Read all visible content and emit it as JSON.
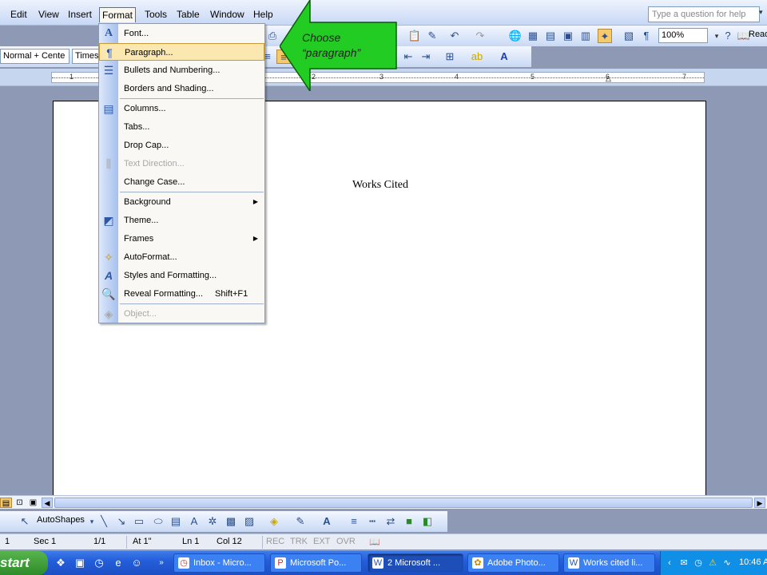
{
  "menubar": {
    "items": [
      "Edit",
      "View",
      "Insert",
      "Format",
      "Tools",
      "Table",
      "Window",
      "Help"
    ],
    "help_placeholder": "Type a question for help"
  },
  "toolbar_std": {
    "zoom": "100%",
    "read_label": "Read"
  },
  "toolbar_fmt": {
    "style": "Normal + Cente",
    "font": "Times"
  },
  "ruler": {
    "numbers": [
      "1",
      "1",
      "2",
      "3",
      "4",
      "5",
      "6",
      "7"
    ]
  },
  "format_menu": {
    "items": [
      {
        "label": "Font...",
        "icon": "font-icon"
      },
      {
        "label": "Paragraph...",
        "icon": "paragraph-icon"
      },
      {
        "label": "Bullets and Numbering...",
        "icon": "bullets-icon"
      },
      {
        "label": "Borders and Shading...",
        "icon": ""
      },
      {
        "label": "Columns...",
        "icon": "columns-icon"
      },
      {
        "label": "Tabs...",
        "icon": ""
      },
      {
        "label": "Drop Cap...",
        "icon": ""
      },
      {
        "label": "Text Direction...",
        "icon": "text-direction-icon"
      },
      {
        "label": "Change Case...",
        "icon": ""
      },
      {
        "label": "Background",
        "icon": ""
      },
      {
        "label": "Theme...",
        "icon": "theme-icon"
      },
      {
        "label": "Frames",
        "icon": ""
      },
      {
        "label": "AutoFormat...",
        "icon": "autoformat-icon"
      },
      {
        "label": "Styles and Formatting...",
        "icon": "styles-icon"
      },
      {
        "label": "Reveal Formatting...",
        "icon": "reveal-formatting-icon"
      },
      {
        "label": "Object...",
        "icon": "object-icon"
      }
    ],
    "reveal_shortcut": "Shift+F1"
  },
  "callout": {
    "text": "Choose\n“paragraph”",
    "color": "#22cc22"
  },
  "document": {
    "title": "Works Cited"
  },
  "drawing_toolbar": {
    "autoshapes_label": "AutoShapes"
  },
  "statusbar": {
    "page": "1",
    "section": "Sec 1",
    "page_of": "1/1",
    "at": "At 1\"",
    "line": "Ln 1",
    "col": "Col 12",
    "rec": "REC",
    "trk": "TRK",
    "ext": "EXT",
    "ovr": "OVR"
  },
  "taskbar": {
    "start_label": "start",
    "tasks": [
      "Inbox - Micro...",
      "Microsoft Po...",
      "2 Microsoft ...",
      "Adobe Photo...",
      "Works cited li..."
    ],
    "clock": "10:46 A"
  },
  "colors": {
    "accent": "#316ac5",
    "menu_highlight": "#fbe8b0",
    "callout_green": "#22cc22"
  }
}
